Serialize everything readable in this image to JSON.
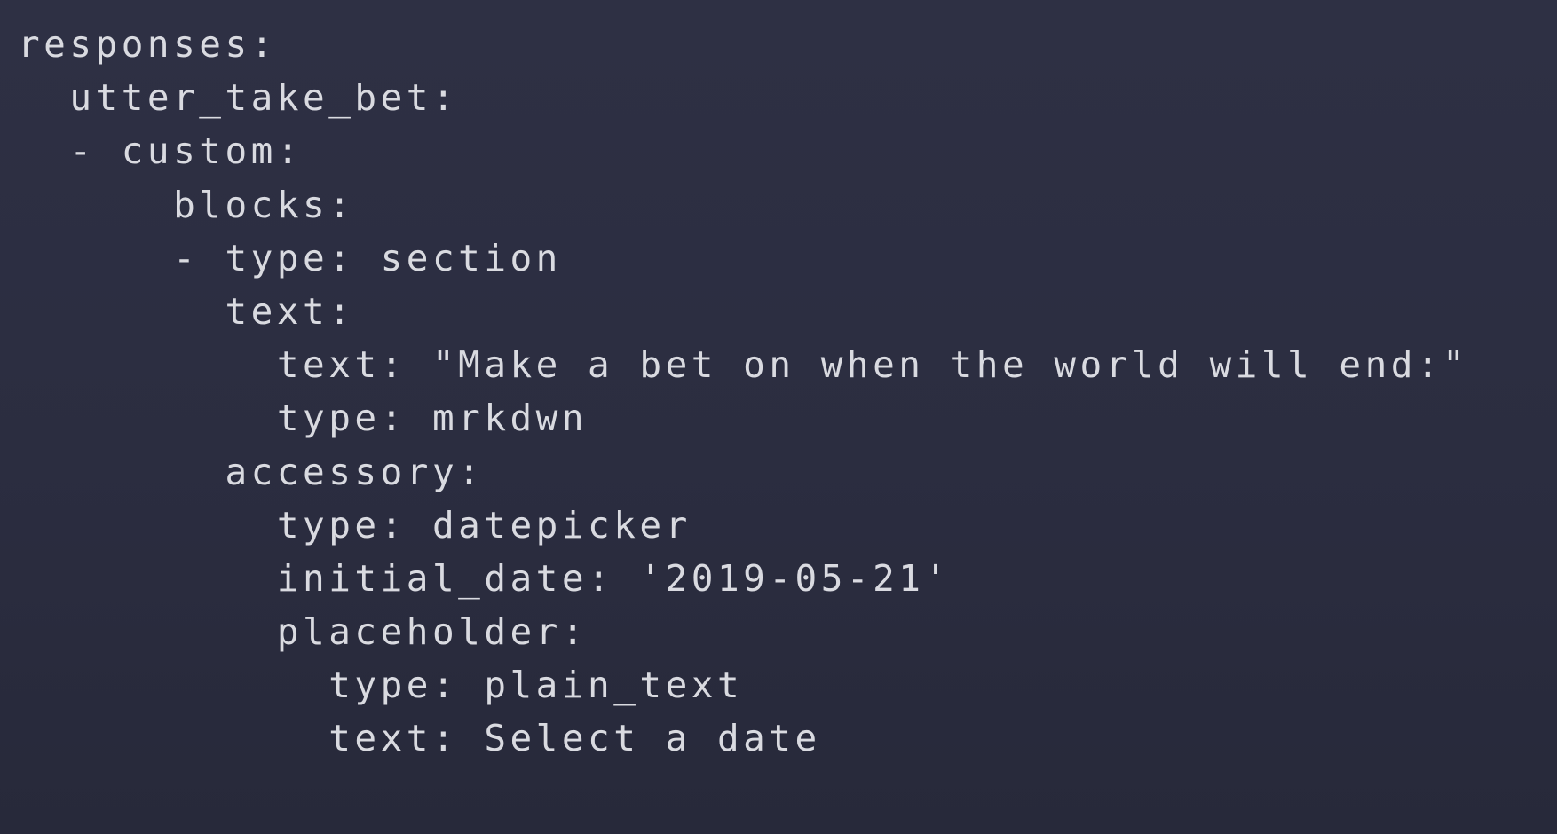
{
  "editor": {
    "lines": [
      "responses:",
      "  utter_take_bet:",
      "  - custom:",
      "      blocks:",
      "      - type: section",
      "        text:",
      "          text: \"Make a bet on when the world will end:\"",
      "          type: mrkdwn",
      "        accessory:",
      "          type: datepicker",
      "          initial_date: '2019-05-21'",
      "          placeholder:",
      "            type: plain_text",
      "            text: Select a date"
    ]
  },
  "colors": {
    "background": "#2c2e41",
    "text": "#d9dae0"
  }
}
